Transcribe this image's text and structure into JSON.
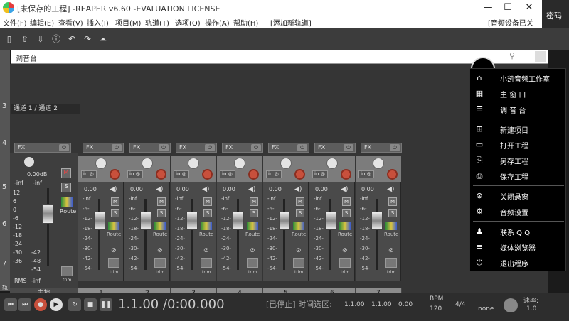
{
  "window": {
    "title": "[未保存的工程] -REAPER v6.60 -EVALUATION LICENSE",
    "minimize": "—",
    "maximize": "☐",
    "close": "✕"
  },
  "right_peek": "密码",
  "menu": {
    "items": [
      "文件(F)",
      "编辑(E)",
      "查看(V)",
      "插入(I)",
      "项目(M)",
      "轨道(T)",
      "选项(O)",
      "操作(A)",
      "帮助(H)"
    ],
    "add_track": "[添加新轨道]",
    "audio_status": "[音频设备已关闭]"
  },
  "mixer_window": {
    "title": "调音台",
    "track_name": "通道 1 / 通道 2",
    "fx_label": "FX",
    "in_label": "in",
    "vol_text": "0.00",
    "peak_inf": "-inf",
    "scale": [
      "-6-",
      "-12-",
      "-18-",
      "-24-",
      "-30-",
      "-42-",
      "-54-"
    ],
    "mute": "M",
    "solo": "S",
    "route": "Route",
    "trim": "trim",
    "phase": "⊘",
    "channel_numbers": [
      "1",
      "2",
      "3",
      "4",
      "5",
      "6",
      "7"
    ],
    "master_label": "主控",
    "master_db": "0.00dB",
    "master_rms": "RMS",
    "master_scale": [
      "12",
      "6",
      "0",
      "-6",
      "-12",
      "-18",
      "-24",
      "-30",
      "-36",
      "-42",
      "-48",
      "-54"
    ],
    "row_numbers": [
      "3",
      "4",
      "5",
      "6",
      "7"
    ],
    "bottom_gutter": "轨道"
  },
  "transport": {
    "time": "1.1.00 /0:00.000",
    "selection_label": "[已停止] 时间选区:",
    "sel_start": "1.1.00",
    "sel_end": "1.1.00",
    "sel_len": "0.00",
    "bpm_label": "BPM",
    "bpm": "120",
    "sig": "4/4",
    "rate_label": "速率:",
    "rate": "1.0",
    "none": "none"
  },
  "context_menu": {
    "items": [
      {
        "icon": "home-icon",
        "glyph": "⌂",
        "label": "小凯音频工作室"
      },
      {
        "icon": "grid-icon",
        "glyph": "▦",
        "label": "主 窗 口"
      },
      {
        "icon": "menu-icon",
        "glyph": "☰",
        "label": "调 音 台"
      },
      {
        "icon": "new-project-icon",
        "glyph": "⊞",
        "label": "新建项目"
      },
      {
        "icon": "open-project-icon",
        "glyph": "▭",
        "label": "打开工程"
      },
      {
        "icon": "save-as-icon",
        "glyph": "⎘",
        "label": "另存工程"
      },
      {
        "icon": "save-icon",
        "glyph": "⎙",
        "label": "保存工程"
      },
      {
        "icon": "close-float-icon",
        "glyph": "⊗",
        "label": "关闭悬窗"
      },
      {
        "icon": "gear-icon",
        "glyph": "⚙",
        "label": "音频设置"
      },
      {
        "icon": "qq-icon",
        "glyph": "♟",
        "label": "联系 Q Q"
      },
      {
        "icon": "media-browser-icon",
        "glyph": "≡",
        "label": "媒体浏览器"
      },
      {
        "icon": "power-icon",
        "glyph": "⏻",
        "label": "退出程序"
      }
    ]
  }
}
